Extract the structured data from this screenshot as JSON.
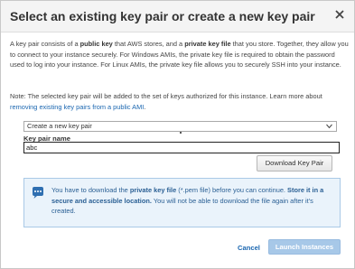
{
  "dialog": {
    "title": "Select an existing key pair or create a new key pair",
    "close_icon": "close-icon"
  },
  "intro": {
    "t1": "A key pair consists of a ",
    "b1": "public key",
    "t2": " that AWS stores, and a ",
    "b2": "private key file",
    "t3": " that you store. Together, they allow you to connect to your instance securely. For Windows AMIs, the private key file is required to obtain the password used to log into your instance. For Linux AMIs, the private key file allows you to securely SSH into your instance."
  },
  "note": {
    "text": "Note: The selected key pair will be added to the set of keys authorized for this instance. Learn more about ",
    "link": "removing existing key pairs from a public AMI",
    "end": "."
  },
  "key_pair_select": {
    "value": "Create a new key pair"
  },
  "key_pair_name": {
    "label": "Key pair name",
    "value": "abc"
  },
  "download_button": {
    "label": "Download Key Pair"
  },
  "info": {
    "icon": "speech-bubble-icon",
    "t1": "You have to download the ",
    "b1": "private key file",
    "t2": " (*.pem file) before you can continue. ",
    "b2": "Store it in a secure and accessible location.",
    "t3": " You will not be able to download the file again after it's created."
  },
  "footer": {
    "cancel_label": "Cancel",
    "launch_label": "Launch Instances"
  },
  "colors": {
    "link": "#1a66b0",
    "info_bg": "#eaf3fb",
    "info_text": "#2a5f94",
    "primary_disabled": "#a7c8e8"
  }
}
